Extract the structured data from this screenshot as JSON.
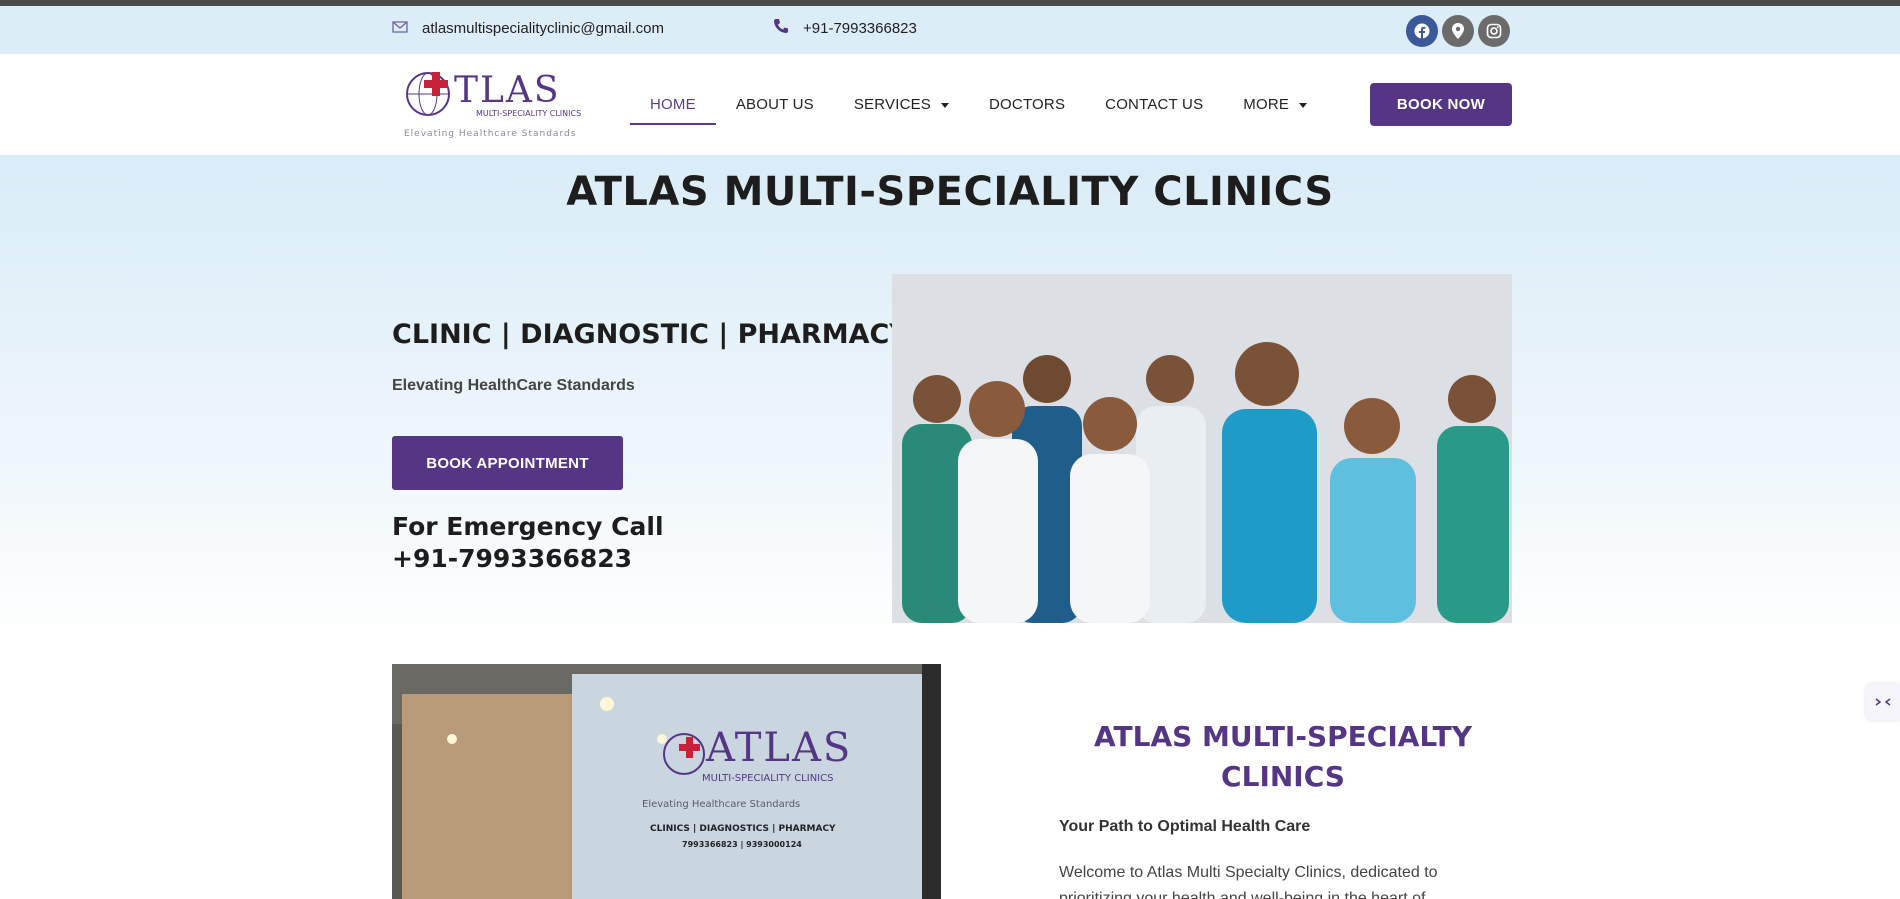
{
  "topbar": {
    "email": "atlasmultispecialityclinic@gmail.com",
    "phone": "+91-7993366823",
    "socials": [
      "facebook-icon",
      "map-pin-icon",
      "instagram-icon"
    ]
  },
  "logo": {
    "name": "ATLAS",
    "subtitle": "MULTI-SPECIALITY CLINICS",
    "tagline": "Elevating Healthcare Standards"
  },
  "nav": {
    "items": [
      {
        "label": "HOME",
        "active": true
      },
      {
        "label": "ABOUT US"
      },
      {
        "label": "SERVICES",
        "dropdown": true
      },
      {
        "label": "DOCTORS"
      },
      {
        "label": "CONTACT US"
      },
      {
        "label": "MORE",
        "dropdown": true
      }
    ],
    "cta": "BOOK NOW"
  },
  "hero": {
    "title": "ATLAS MULTI-SPECIALITY CLINICS",
    "subhead": "CLINIC | DIAGNOSTIC | PHARMACY",
    "tagline": "Elevating HealthCare Standards",
    "button": "BOOK APPOINTMENT",
    "emergency_label": "For Emergency Call",
    "emergency_phone": "+91-7993366823"
  },
  "clinic_sign": {
    "name": "ATLAS",
    "subtitle": "MULTI-SPECIALITY CLINICS",
    "tagline": "Elevating Healthcare Standards",
    "services": "CLINICS | DIAGNOSTICS | PHARMACY",
    "phones": "7993366823 | 9393000124"
  },
  "about": {
    "title": "ATLAS MULTI-SPECIALTY CLINICS",
    "subtitle": "Your Path to Optimal Health Care",
    "body": "Welcome to Atlas Multi Specialty Clinics, dedicated to prioritizing your health and well-being in the heart of"
  },
  "colors": {
    "brand": "#553684",
    "infobar": "#dcedf7",
    "facebook": "#3b5998"
  }
}
